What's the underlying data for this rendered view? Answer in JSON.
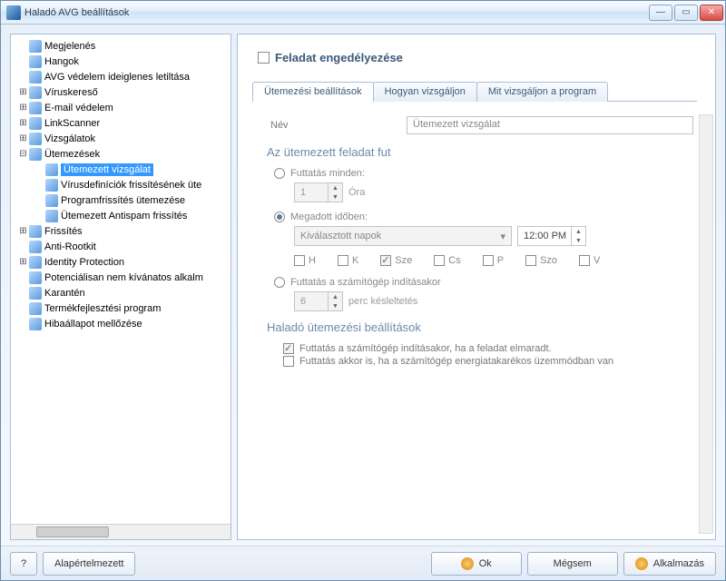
{
  "window": {
    "title": "Haladó AVG beállítások"
  },
  "tree": {
    "items": [
      {
        "label": "Megjelenés",
        "depth": 1,
        "expander": ""
      },
      {
        "label": "Hangok",
        "depth": 1,
        "expander": ""
      },
      {
        "label": "AVG védelem ideiglenes letiltása",
        "depth": 1,
        "expander": ""
      },
      {
        "label": "Víruskereső",
        "depth": 1,
        "expander": "+"
      },
      {
        "label": "E-mail védelem",
        "depth": 1,
        "expander": "+"
      },
      {
        "label": "LinkScanner",
        "depth": 1,
        "expander": "+"
      },
      {
        "label": "Vizsgálatok",
        "depth": 1,
        "expander": "+"
      },
      {
        "label": "Ütemezések",
        "depth": 1,
        "expander": "−"
      },
      {
        "label": "Ütemezett vizsgálat",
        "depth": 2,
        "expander": "",
        "selected": true
      },
      {
        "label": "Vírusdefiníciók frissítésének üte",
        "depth": 2,
        "expander": ""
      },
      {
        "label": "Programfrissítés ütemezése",
        "depth": 2,
        "expander": ""
      },
      {
        "label": "Ütemezett Antispam frissítés",
        "depth": 2,
        "expander": ""
      },
      {
        "label": "Frissítés",
        "depth": 1,
        "expander": "+"
      },
      {
        "label": "Anti-Rootkit",
        "depth": 1,
        "expander": ""
      },
      {
        "label": "Identity Protection",
        "depth": 1,
        "expander": "+"
      },
      {
        "label": "Potenciálisan nem kívánatos alkalm",
        "depth": 1,
        "expander": ""
      },
      {
        "label": "Karantén",
        "depth": 1,
        "expander": ""
      },
      {
        "label": "Termékfejlesztési program",
        "depth": 1,
        "expander": ""
      },
      {
        "label": "Hibaállapot mellőzése",
        "depth": 1,
        "expander": ""
      }
    ]
  },
  "task_enable_label": "Feladat engedélyezése",
  "tabs": {
    "schedule": "Ütemezési beállítások",
    "how": "Hogyan vizsgáljon",
    "what": "Mit vizsgáljon a program"
  },
  "name_label": "Név",
  "name_value": "Ütemezett vizsgálat",
  "section_running": "Az ütemezett feladat fut",
  "radio_every": "Futtatás minden:",
  "every_value": "1",
  "every_unit": "Óra",
  "radio_attime": "Megadott időben:",
  "dropdown_days": "Kiválasztott napok",
  "time_value": "12:00 PM",
  "days": {
    "H": "H",
    "K": "K",
    "Sze": "Sze",
    "Cs": "Cs",
    "P": "P",
    "Szo": "Szo",
    "V": "V"
  },
  "radio_onstart": "Futtatás a számítógép indításakor",
  "onstart_value": "6",
  "onstart_unit": "perc késleltetés",
  "section_advanced": "Haladó ütemezési beállítások",
  "adv1": "Futtatás a számítógép indításakor, ha a feladat elmaradt.",
  "adv2": "Futtatás akkor is, ha a számítógép energiatakarékos üzemmódban van",
  "footer": {
    "help": "?",
    "default": "Alapértelmezett",
    "ok": "Ok",
    "cancel": "Mégsem",
    "apply": "Alkalmazás"
  }
}
